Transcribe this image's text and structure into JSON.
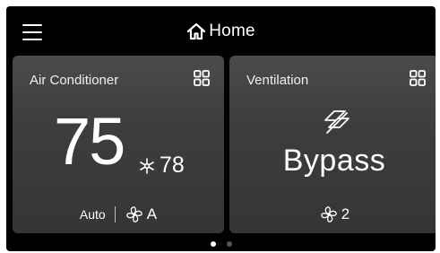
{
  "header": {
    "title": "Home",
    "menu_icon": "hamburger-menu-icon",
    "home_icon": "home-icon"
  },
  "cards": [
    {
      "label": "Air Conditioner",
      "current_temp": "75",
      "setpoint_icon": "snowflake-icon",
      "setpoint": "78",
      "mode": "Auto",
      "fan_icon": "fan-icon",
      "fan_speed": "A",
      "menu_icon": "grid-icon"
    },
    {
      "label": "Ventilation",
      "status_icon": "bypass-icon",
      "status": "Bypass",
      "fan_icon": "fan-icon",
      "fan_speed": "2",
      "menu_icon": "grid-icon"
    }
  ],
  "pagination": {
    "pages": 2,
    "current": 1
  },
  "colors": {
    "background": "#000000",
    "card": "#404040",
    "text": "#ffffff",
    "dot_inactive": "#555555"
  }
}
